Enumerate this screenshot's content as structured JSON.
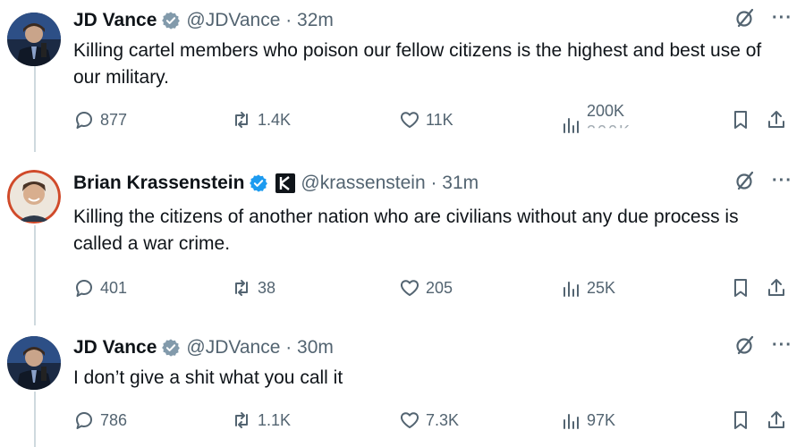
{
  "tweets": [
    {
      "name": "JD Vance",
      "handle": "@JDVance · 32m",
      "text": "Killing cartel members who poison our fellow citizens is the highest and best use of our military.",
      "replies": "877",
      "reposts": "1.4K",
      "likes": "11K",
      "views": "200K",
      "verified": "gray-checkmark-badge"
    },
    {
      "name": "Brian Krassenstein",
      "handle": "@krassenstein · 31m",
      "text": "Killing the citizens of another nation who are civilians without any due process is called a war crime.",
      "replies": "401",
      "reposts": "38",
      "likes": "205",
      "views": "25K",
      "verified": "blue-checkmark-badge"
    },
    {
      "name": "JD Vance",
      "handle": "@JDVance · 30m",
      "text": "I don’t give a shit what you call it",
      "replies": "786",
      "reposts": "1.1K",
      "likes": "7.3K",
      "views": "97K",
      "verified": "gray-checkmark-badge"
    }
  ],
  "colors": {
    "text": "#0f1419",
    "muted": "#536471",
    "verified_blue": "#1d9bf0",
    "verified_gray": "#829aab",
    "thread_line": "#cfd9de"
  },
  "icons": {
    "reply": "reply-icon",
    "repost": "repost-icon",
    "like": "heart-icon",
    "views": "views-chart-icon",
    "bookmark": "bookmark-icon",
    "share": "share-icon",
    "grok": "grok-icon",
    "more": "more-icon"
  }
}
